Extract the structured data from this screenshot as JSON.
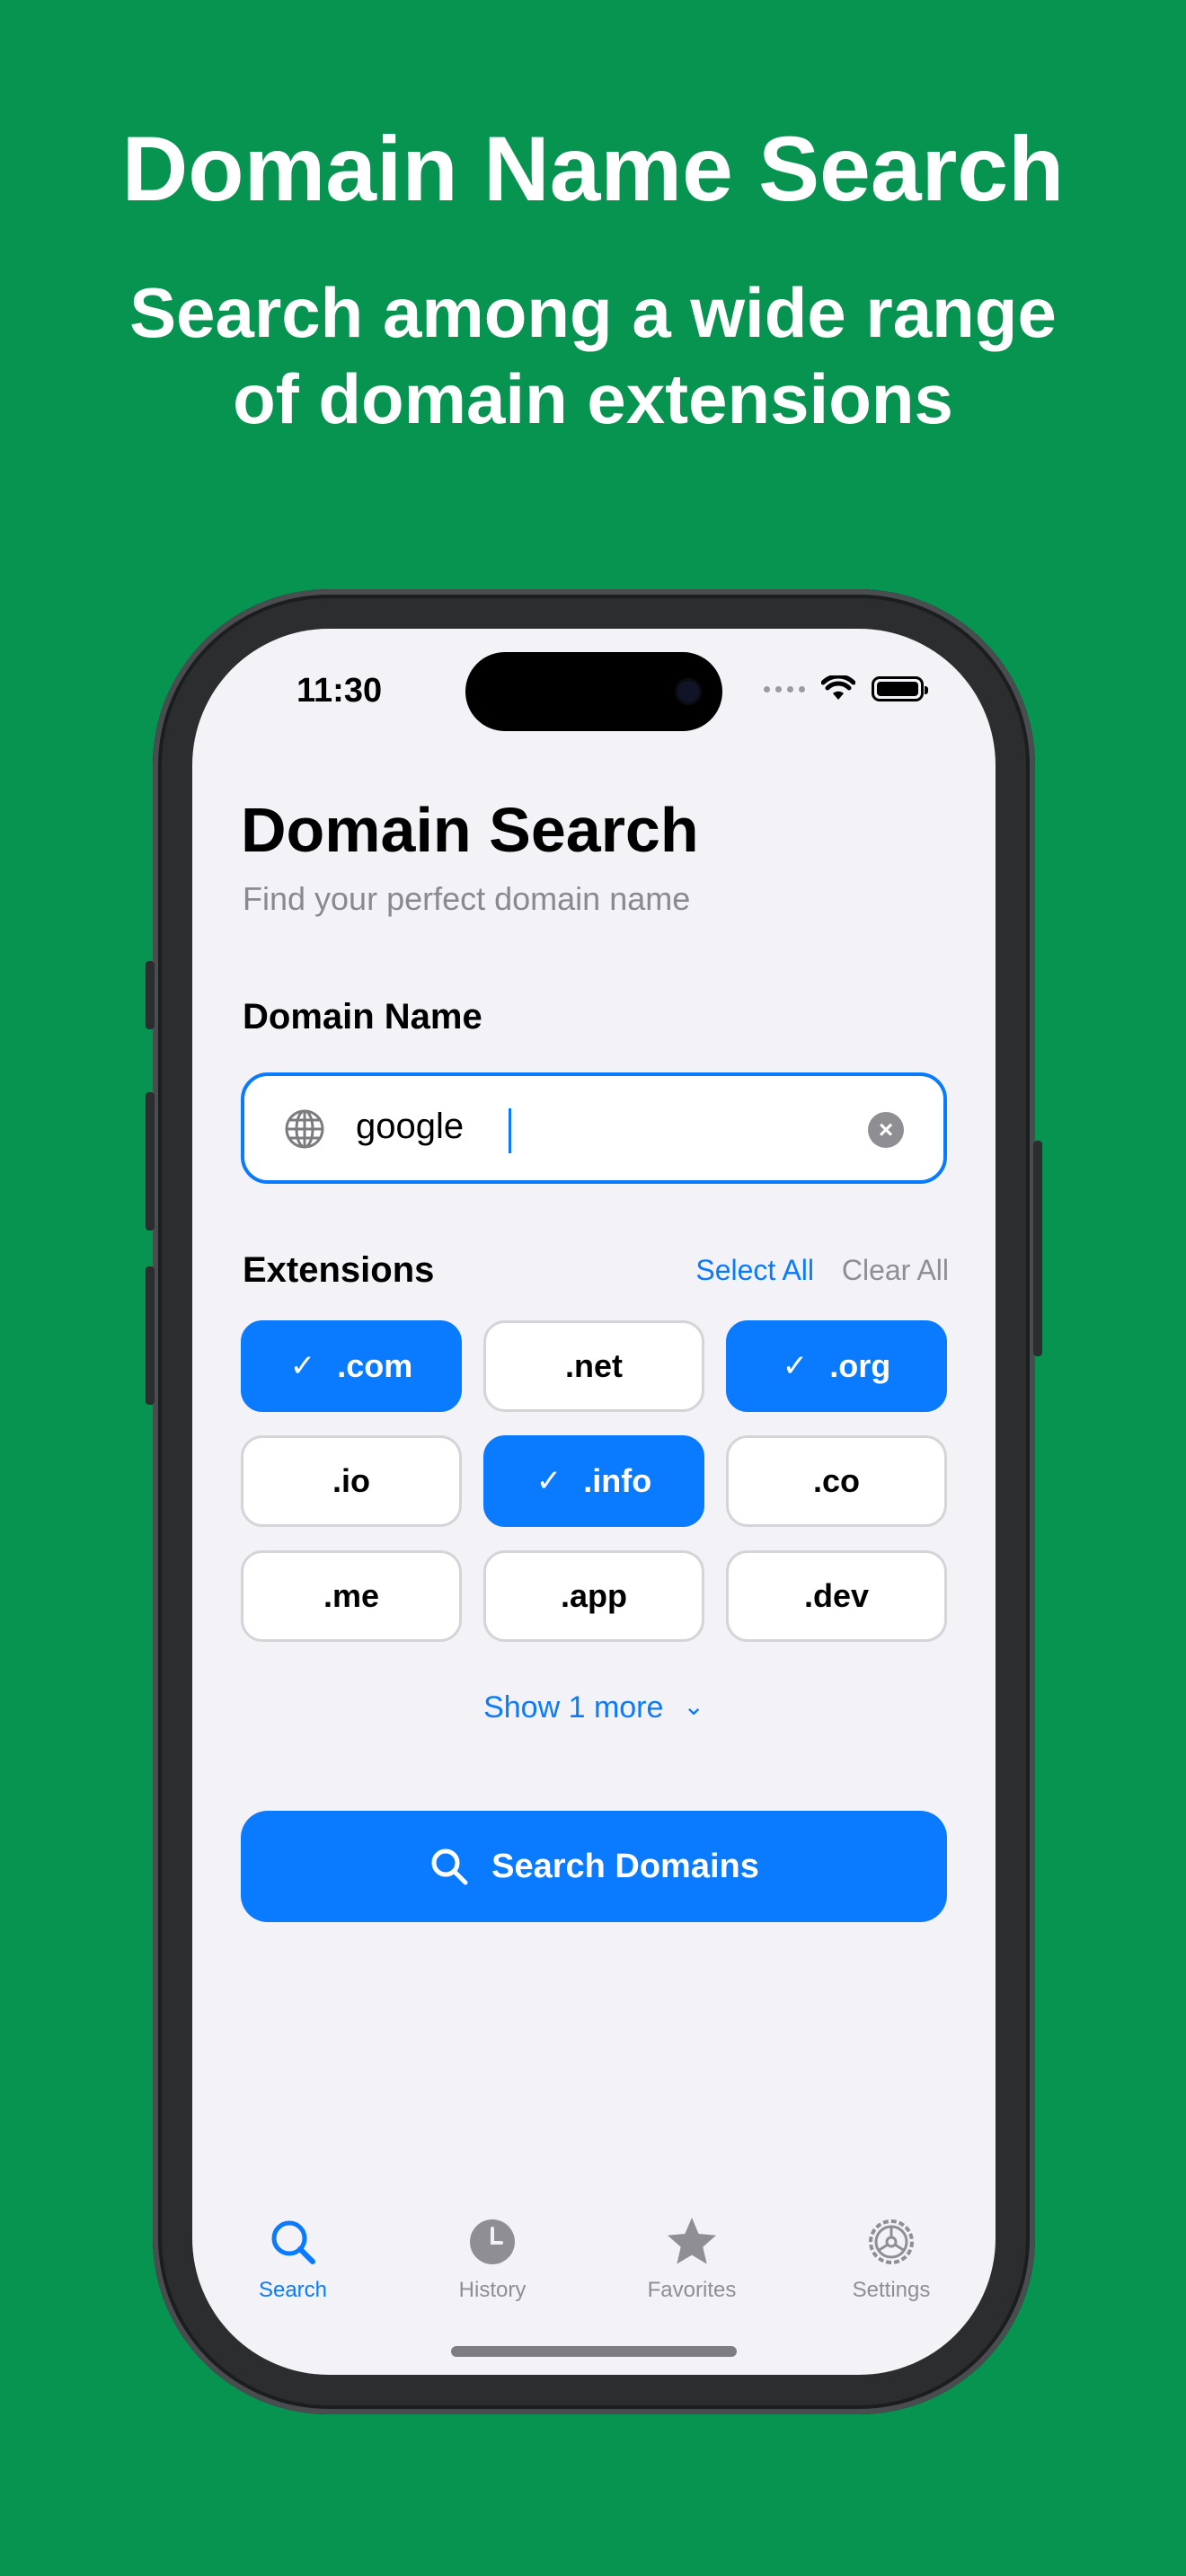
{
  "promo": {
    "title": "Domain Name Search",
    "subtitle_line1": "Search among a wide range",
    "subtitle_line2": "of domain extensions"
  },
  "status_bar": {
    "time": "11:30"
  },
  "page": {
    "title": "Domain Search",
    "subtitle": "Find your perfect domain name"
  },
  "domain_input": {
    "label": "Domain Name",
    "value": "google",
    "clear_symbol": "×"
  },
  "extensions": {
    "label": "Extensions",
    "select_all": "Select All",
    "clear_all": "Clear All",
    "check_mark": "✓",
    "items": [
      {
        "label": ".com",
        "selected": true
      },
      {
        "label": ".net",
        "selected": false
      },
      {
        "label": ".org",
        "selected": true
      },
      {
        "label": ".io",
        "selected": false
      },
      {
        "label": ".info",
        "selected": true
      },
      {
        "label": ".co",
        "selected": false
      },
      {
        "label": ".me",
        "selected": false
      },
      {
        "label": ".app",
        "selected": false
      },
      {
        "label": ".dev",
        "selected": false
      }
    ],
    "show_more": "Show 1 more"
  },
  "search_button": {
    "label": "Search Domains"
  },
  "tabbar": {
    "tabs": [
      {
        "label": "Search",
        "icon": "search-icon",
        "active": true
      },
      {
        "label": "History",
        "icon": "clock-icon",
        "active": false
      },
      {
        "label": "Favorites",
        "icon": "star-icon",
        "active": false
      },
      {
        "label": "Settings",
        "icon": "gear-icon",
        "active": false
      }
    ]
  },
  "colors": {
    "background": "#079451",
    "accent": "#0a7aff",
    "screen": "#f2f2f7",
    "muted": "#8e8e93"
  }
}
